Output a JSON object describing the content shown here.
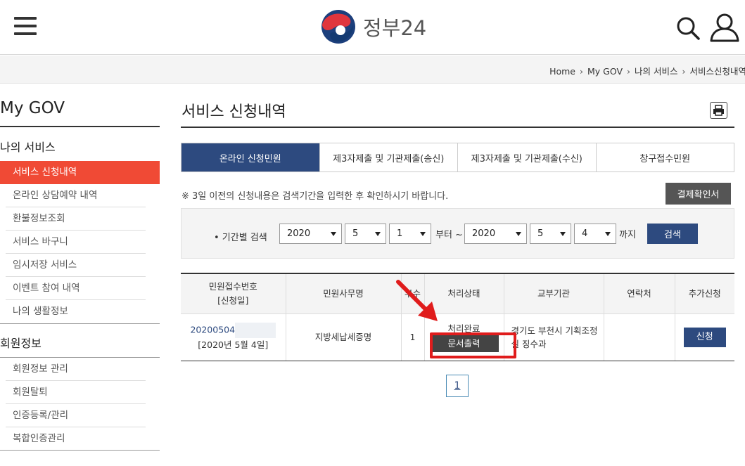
{
  "header": {
    "logo_text": "정부24",
    "menu_icon": "hamburger-icon",
    "search_icon": "search-icon",
    "user_icon": "user-icon"
  },
  "breadcrumb": [
    "Home",
    "My GOV",
    "나의 서비스",
    "서비스신청내역"
  ],
  "sidebar": {
    "title": "My GOV",
    "groups": [
      {
        "label": "나의 서비스",
        "items": [
          "서비스 신청내역",
          "온라인 상담예약 내역",
          "환불정보조회",
          "서비스 바구니",
          "임시저장 서비스",
          "이벤트 참여 내역",
          "나의 생활정보"
        ]
      },
      {
        "label": "회원정보",
        "items": [
          "회원정보 관리",
          "회원탈퇴",
          "인증등록/관리",
          "복합인증관리"
        ]
      }
    ],
    "active_item": "서비스 신청내역"
  },
  "main": {
    "title": "서비스 신청내역",
    "print_icon": "printer-icon",
    "tabs": [
      "온라인 신청민원",
      "제3자제출 및 기관제출(송신)",
      "제3자제출 및 기관제출(수신)",
      "창구접수민원"
    ],
    "active_tab": "온라인 신청민원",
    "notice": "※ 3일 이전의 신청내용은 검색기간을 입력한 후 확인하시기 바랍니다.",
    "receipt_button": "결제확인서",
    "search": {
      "label": "• 기간별 검색",
      "from_year": "2020",
      "from_month": "5",
      "from_day": "1",
      "from_word": "부터 ~",
      "to_year": "2020",
      "to_month": "5",
      "to_day": "4",
      "to_word": "까지",
      "button": "검색"
    },
    "table": {
      "headers": [
        "민원접수번호",
        "[신청일]",
        "민원사무명",
        "부수",
        "처리상태",
        "교부기관",
        "연락처",
        "추가신청"
      ],
      "row": {
        "receipt_no": "20200504",
        "date": "[2020년 5월 4일]",
        "service": "지방세납세증명",
        "copies": "1",
        "status": "처리완료",
        "status_button": "문서출력",
        "agency": "경기도 부천시 기획조정실 징수과",
        "contact": "",
        "apply_button": "신청"
      }
    },
    "pagination": [
      "1"
    ]
  },
  "colors": {
    "brand_navy": "#2d4a7f",
    "active_red": "#f04a35",
    "highlight_red": "#e01c1c"
  }
}
